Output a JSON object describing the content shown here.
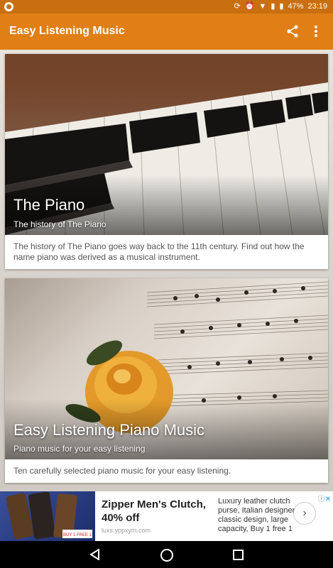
{
  "status_bar": {
    "battery": "47%",
    "time": "23:19"
  },
  "app_bar": {
    "title": "Easy Listening Music",
    "share_icon": "share-icon",
    "more_icon": "more-vert-icon"
  },
  "cards": [
    {
      "title": "The Piano",
      "subtitle": "The history of The Piano",
      "description": "The history of The Piano goes way back to the 11th century. Find out how the name piano was derived as a musical instrument."
    },
    {
      "title": "Easy Listening Piano Music",
      "subtitle": "Piano music for your easy listening",
      "description": "Ten carefully selected piano music for your easy listening."
    }
  ],
  "ad": {
    "headline": "Zipper Men's Clutch, 40% off",
    "url": "luxs.yppxym.com",
    "body": "Luxury leather clutch purse, Italian designer classic design, large capacity, Buy 1 free 1",
    "image_badge": "BUY 1 FREE 1"
  },
  "colors": {
    "primary": "#e07f16",
    "primary_dark": "#c96f0f"
  }
}
